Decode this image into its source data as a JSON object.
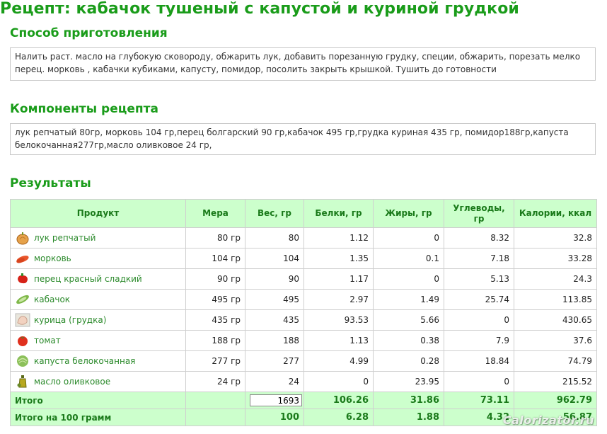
{
  "title": "Рецепт: кабачок тушеный с капустой и куриной грудкой",
  "method": {
    "heading": "Способ приготовления",
    "text": "Налить раст. масло на глубокую сковороду, обжарить лук, добавить порезанную грудку, специи, обжарить, порезать мелко перец. морковь , кабачки кубиками, капусту, помидор, посолить закрыть крышкой. Тушить до готовности"
  },
  "components": {
    "heading": "Компоненты рецепта",
    "text": "лук репчатый 80гр, морковь 104 гр,перец болгарский 90 гр,кабачок 495 гр,грудка куриная 435 гр, помидор188гр,капуста белокочанная277гр,масло оливковое 24 гр,"
  },
  "results": {
    "heading": "Результаты",
    "columns": [
      "Продукт",
      "Мера",
      "Вес, гр",
      "Белки, гр",
      "Жиры, гр",
      "Углеводы, гр",
      "Калории, ккал"
    ],
    "rows": [
      {
        "icon": "onion-icon",
        "name": "лук репчатый",
        "measure": "80 гр",
        "weight": "80",
        "protein": "1.12",
        "fat": "0",
        "carbs": "8.32",
        "kcal": "32.8"
      },
      {
        "icon": "carrot-icon",
        "name": "морковь",
        "measure": "104 гр",
        "weight": "104",
        "protein": "1.35",
        "fat": "0.1",
        "carbs": "7.18",
        "kcal": "33.28"
      },
      {
        "icon": "red-pepper-icon",
        "name": "перец красный сладкий",
        "measure": "90 гр",
        "weight": "90",
        "protein": "1.17",
        "fat": "0",
        "carbs": "5.13",
        "kcal": "24.3"
      },
      {
        "icon": "zucchini-icon",
        "name": "кабачок",
        "measure": "495 гр",
        "weight": "495",
        "protein": "2.97",
        "fat": "1.49",
        "carbs": "25.74",
        "kcal": "113.85"
      },
      {
        "icon": "chicken-breast-icon",
        "name": "курица (грудка)",
        "measure": "435 гр",
        "weight": "435",
        "protein": "93.53",
        "fat": "5.66",
        "carbs": "0",
        "kcal": "430.65"
      },
      {
        "icon": "tomato-icon",
        "name": "томат",
        "measure": "188 гр",
        "weight": "188",
        "protein": "1.13",
        "fat": "0.38",
        "carbs": "7.9",
        "kcal": "37.6"
      },
      {
        "icon": "cabbage-icon",
        "name": "капуста белокочанная",
        "measure": "277 гр",
        "weight": "277",
        "protein": "4.99",
        "fat": "0.28",
        "carbs": "18.84",
        "kcal": "74.79"
      },
      {
        "icon": "olive-oil-icon",
        "name": "масло оливковое",
        "measure": "24 гр",
        "weight": "24",
        "protein": "0",
        "fat": "23.95",
        "carbs": "0",
        "kcal": "215.52"
      }
    ],
    "total": {
      "label": "Итого",
      "weight": "1693",
      "protein": "106.26",
      "fat": "31.86",
      "carbs": "73.11",
      "kcal": "962.79"
    },
    "per100": {
      "label": "Итого на 100 грамм",
      "weight": "100",
      "protein": "6.28",
      "fat": "1.88",
      "carbs": "4.32",
      "kcal": "56.87"
    }
  },
  "watermark": "Calorizator.ru"
}
